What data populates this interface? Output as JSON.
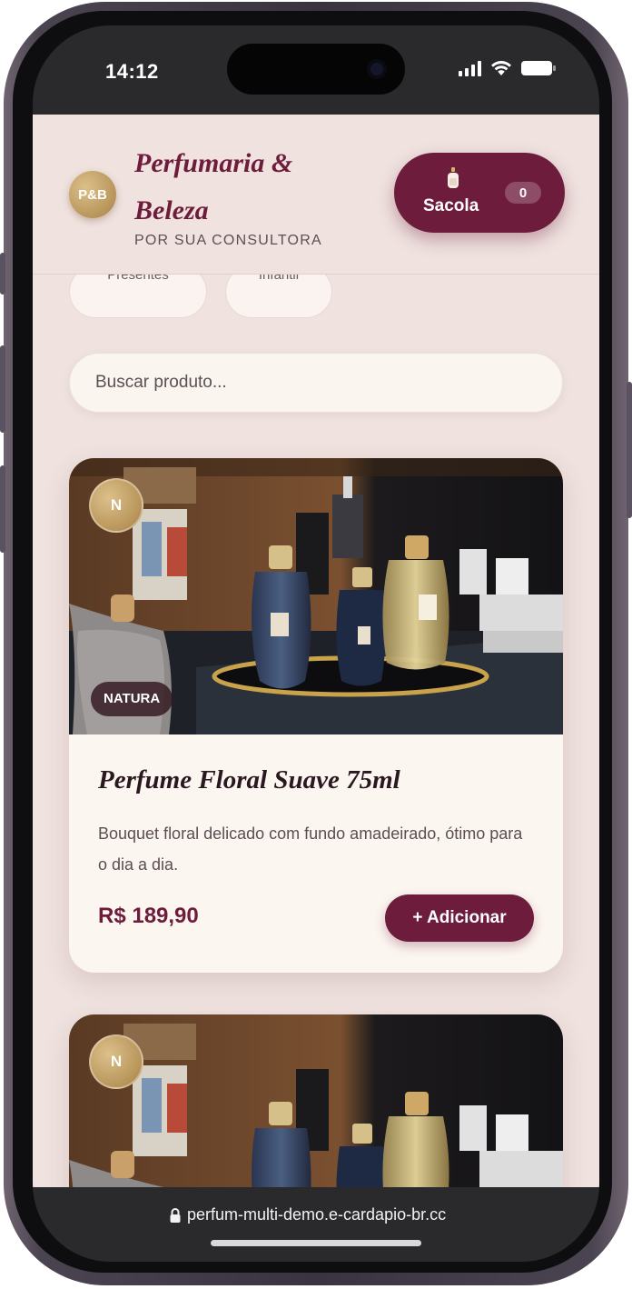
{
  "status_bar": {
    "time": "14:12",
    "icons": [
      "signal-icon",
      "wifi-icon",
      "battery-icon"
    ]
  },
  "header": {
    "logo_initials": "P&B",
    "brand_name": "Perfumaria & Beleza",
    "tagline": "POR SUA CONSULTORA",
    "bag_label": "Sacola",
    "bag_count": "0",
    "bag_icon": "perfume-bottle-icon"
  },
  "categories": {
    "items": [
      "Presentes",
      "Infantil"
    ]
  },
  "search": {
    "placeholder": "Buscar produto..."
  },
  "products": [
    {
      "brand_initial": "N",
      "brand": "NATURA",
      "title": "Perfume Floral Suave 75ml",
      "description": "Bouquet floral delicado com fundo amadeirado, ótimo para o dia a dia.",
      "price": "R$ 189,90",
      "add_label": "+ Adicionar"
    },
    {
      "brand_initial": "N"
    }
  ],
  "browser": {
    "url": "perfum-multi-demo.e-cardapio-br.cc",
    "lock_icon": "lock-icon"
  },
  "colors": {
    "accent": "#6e1c3c",
    "background": "#efe2df",
    "card": "#fcf6f0",
    "gold": "#b8955a"
  }
}
